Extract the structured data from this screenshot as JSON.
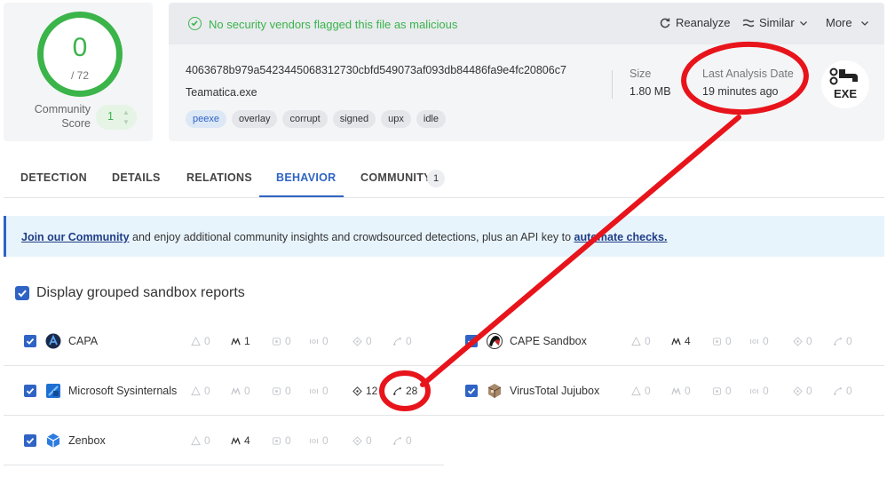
{
  "score": {
    "detections": "0",
    "total": "/ 72"
  },
  "community": {
    "label": "Community Score",
    "value": "1",
    "up_icon": "chevron-up-icon",
    "down_icon": "chevron-down-icon"
  },
  "status": {
    "icon": "check-circle-icon",
    "text": "No security vendors flagged this file as malicious",
    "color": "#3bb44a"
  },
  "actions": {
    "reanalyze": {
      "label": "Reanalyze",
      "icon": "refresh-icon"
    },
    "similar": {
      "label": "Similar",
      "icon": "similar-icon"
    },
    "more": {
      "label": "More"
    }
  },
  "file": {
    "hash": "4063678b979a5423445068312730cbfd549073af093db84486fa9e4fc20806c7",
    "name": "Teamatica.exe",
    "tags": [
      "peexe",
      "overlay",
      "corrupt",
      "signed",
      "upx",
      "idle"
    ],
    "size_label": "Size",
    "size_value": "1.80 MB",
    "date_label": "Last Analysis Date",
    "date_value": "19 minutes ago",
    "type_icon_text": "EXE"
  },
  "tabs": {
    "detection": "DETECTION",
    "details": "DETAILS",
    "relations": "RELATIONS",
    "behavior": "BEHAVIOR",
    "community": "COMMUNITY",
    "community_count": "1",
    "active": "BEHAVIOR"
  },
  "banner": {
    "link1": "Join our Community",
    "text": " and enjoy additional community insights and crowdsourced detections, plus an API key to ",
    "link2": "automate checks."
  },
  "grouped": {
    "label": "Display grouped sandbox reports",
    "checked": true
  },
  "metric_icons": [
    "alert-triangle-icon",
    "mitre-icon",
    "ids-icon",
    "sigma-icon",
    "network-icon",
    "process-tree-icon"
  ],
  "sandboxes": [
    {
      "name": "CAPA",
      "logo": "capa-logo-icon",
      "metrics": [
        "0",
        "1",
        "0",
        "0",
        "0",
        "0"
      ]
    },
    {
      "name": "CAPE Sandbox",
      "logo": "cape-logo-icon",
      "metrics": [
        "0",
        "4",
        "0",
        "0",
        "0",
        "0"
      ]
    },
    {
      "name": "Microsoft Sysinternals",
      "logo": "sysinternals-logo-icon",
      "metrics": [
        "0",
        "0",
        "0",
        "0",
        "12",
        "28"
      ]
    },
    {
      "name": "VirusTotal Jujubox",
      "logo": "jujubox-logo-icon",
      "metrics": [
        "0",
        "0",
        "0",
        "0",
        "0",
        "0"
      ]
    },
    {
      "name": "Zenbox",
      "logo": "zenbox-logo-icon",
      "metrics": [
        "0",
        "4",
        "0",
        "0",
        "0",
        "0"
      ]
    }
  ],
  "annotation": {
    "color": "#e8141b"
  },
  "colors": {
    "accent": "#2f64c5",
    "success": "#3bb44a"
  }
}
